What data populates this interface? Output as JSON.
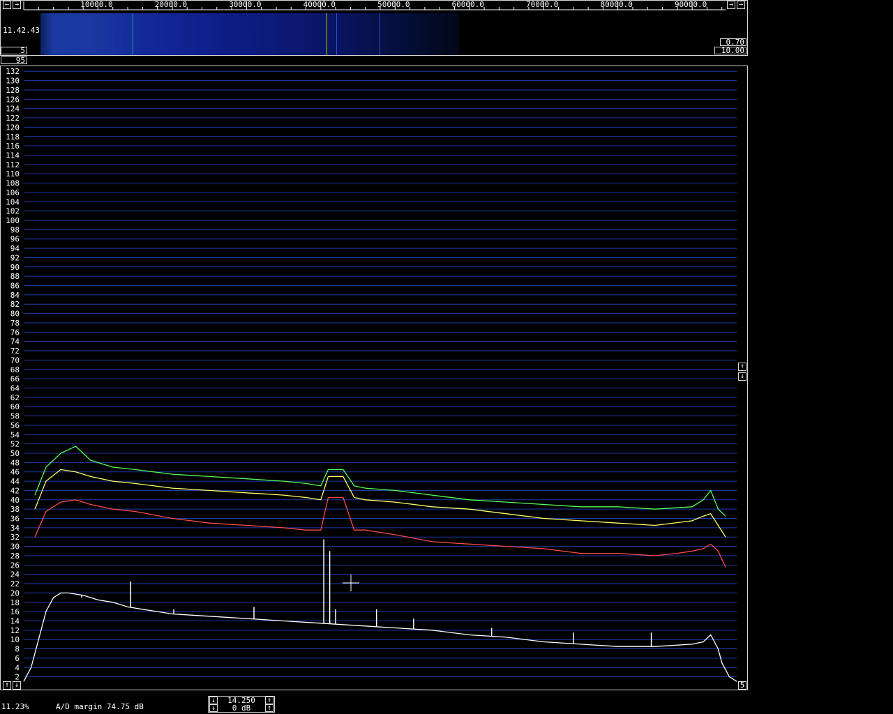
{
  "app": {
    "time": "11.42.43",
    "wf_gain_left": "5",
    "wf_gain_right_top": "0.70",
    "wf_gain_right_bottom": "10.00",
    "avg_box": "95",
    "side_box": "5"
  },
  "status": {
    "cpu": "11.23%",
    "ad_margin": "A/D margin 74.75 dB",
    "level_value": "14.250",
    "level_db": "0 dB"
  },
  "colors": {
    "background": "#000000",
    "grid": "#1f3ba8",
    "green": "#55ff55",
    "yellow": "#ffff66",
    "red": "#ff4a4a",
    "white": "#ffffff",
    "waterfall_marker": "#c8b800"
  },
  "icons": {
    "left": "arrow-left-icon",
    "right": "arrow-right-icon",
    "up": "arrow-up-icon",
    "down": "arrow-down-icon"
  },
  "chart_data": {
    "type": "line",
    "title": "",
    "xlabel": "",
    "ylabel": "",
    "xlim": [
      0,
      96000
    ],
    "ylim": [
      0,
      133
    ],
    "grid": true,
    "x_tick_labels": [
      "10000.0",
      "20000.0",
      "30000.0",
      "40000.0",
      "50000.0",
      "60000.0",
      "70000.0",
      "80000.0",
      "90000.0"
    ],
    "x_ticks": [
      10000,
      20000,
      30000,
      40000,
      50000,
      60000,
      70000,
      80000,
      90000
    ],
    "y_ticks": [
      2,
      4,
      6,
      8,
      10,
      12,
      14,
      16,
      18,
      20,
      22,
      24,
      26,
      28,
      30,
      32,
      34,
      36,
      38,
      40,
      42,
      44,
      46,
      48,
      50,
      52,
      54,
      56,
      58,
      60,
      62,
      64,
      66,
      68,
      70,
      72,
      74,
      76,
      78,
      80,
      82,
      84,
      86,
      88,
      90,
      92,
      94,
      96,
      98,
      100,
      102,
      104,
      106,
      108,
      110,
      112,
      114,
      116,
      118,
      120,
      122,
      124,
      126,
      128,
      130,
      132
    ],
    "series": [
      {
        "color": "#55ff55",
        "x": [
          1500,
          3000,
          5000,
          7000,
          9000,
          12000,
          15000,
          20000,
          25000,
          30000,
          35000,
          38000,
          40000,
          41000,
          43000,
          44500,
          46000,
          50000,
          55000,
          60000,
          65000,
          70000,
          75000,
          80000,
          85000,
          90000,
          91500,
          92500,
          93500,
          94500
        ],
        "y": [
          41,
          47,
          50,
          51.5,
          48.5,
          47,
          46.5,
          45.5,
          45,
          44.5,
          44,
          43.5,
          43,
          46.5,
          46.5,
          43,
          42.5,
          42,
          41,
          40,
          39.5,
          39,
          38.5,
          38.5,
          38,
          38.5,
          40,
          42,
          38,
          36.5
        ]
      },
      {
        "color": "#ffff66",
        "x": [
          1500,
          3000,
          5000,
          7000,
          9000,
          12000,
          15000,
          20000,
          25000,
          30000,
          35000,
          38000,
          40000,
          41000,
          43000,
          44500,
          46000,
          50000,
          55000,
          60000,
          65000,
          70000,
          75000,
          80000,
          85000,
          90000,
          91500,
          92500,
          93500,
          94500
        ],
        "y": [
          38,
          44,
          46.5,
          46,
          45,
          44,
          43.5,
          42.5,
          42,
          41.5,
          41,
          40.5,
          40,
          45,
          45,
          40.5,
          40,
          39.5,
          38.5,
          38,
          37,
          36,
          35.5,
          35,
          34.5,
          35.5,
          36.5,
          37,
          34.5,
          32
        ]
      },
      {
        "color": "#ff4a4a",
        "x": [
          1500,
          3000,
          5000,
          7000,
          9000,
          12000,
          15000,
          20000,
          25000,
          30000,
          35000,
          38000,
          40000,
          41000,
          43000,
          44500,
          46000,
          50000,
          55000,
          60000,
          65000,
          70000,
          75000,
          80000,
          85000,
          88000,
          90000,
          91500,
          92500,
          93500,
          94500
        ],
        "y": [
          32,
          37.5,
          39.5,
          40,
          39,
          38,
          37.5,
          36,
          35,
          34.5,
          34,
          33.5,
          33.5,
          40.5,
          40.5,
          33.5,
          33.5,
          32.5,
          31,
          30.5,
          30,
          29.5,
          28.5,
          28.5,
          28,
          28.5,
          29,
          29.5,
          30.5,
          29,
          25.5
        ]
      },
      {
        "color": "#ffffff",
        "x": [
          0,
          1000,
          2000,
          3000,
          4000,
          5000,
          6000,
          8000,
          10000,
          12000,
          14000,
          16000,
          18000,
          20000,
          25000,
          30000,
          35000,
          40000,
          45000,
          50000,
          55000,
          60000,
          65000,
          70000,
          75000,
          80000,
          85000,
          90000,
          91500,
          92500,
          93500,
          94000,
          95000,
          96000
        ],
        "y": [
          1,
          4,
          10,
          16,
          19,
          20,
          20,
          19.5,
          18.5,
          18,
          17,
          16.5,
          16,
          15.5,
          15,
          14.5,
          14,
          13.5,
          13,
          12.5,
          12,
          11,
          10.5,
          9.5,
          9,
          8.5,
          8.5,
          9,
          9.5,
          11,
          8,
          5,
          2,
          1
        ],
        "spikes": [
          {
            "x": 7800,
            "y": 19
          },
          {
            "x": 14400,
            "y": 22.5
          },
          {
            "x": 20200,
            "y": 16.5
          },
          {
            "x": 31000,
            "y": 17
          },
          {
            "x": 40400,
            "y": 31.5
          },
          {
            "x": 41200,
            "y": 29
          },
          {
            "x": 42000,
            "y": 16.5
          },
          {
            "x": 47500,
            "y": 16.5
          },
          {
            "x": 52500,
            "y": 14.5
          },
          {
            "x": 63000,
            "y": 12.5
          },
          {
            "x": 74000,
            "y": 11.5
          },
          {
            "x": 84500,
            "y": 11.5
          }
        ]
      }
    ]
  }
}
